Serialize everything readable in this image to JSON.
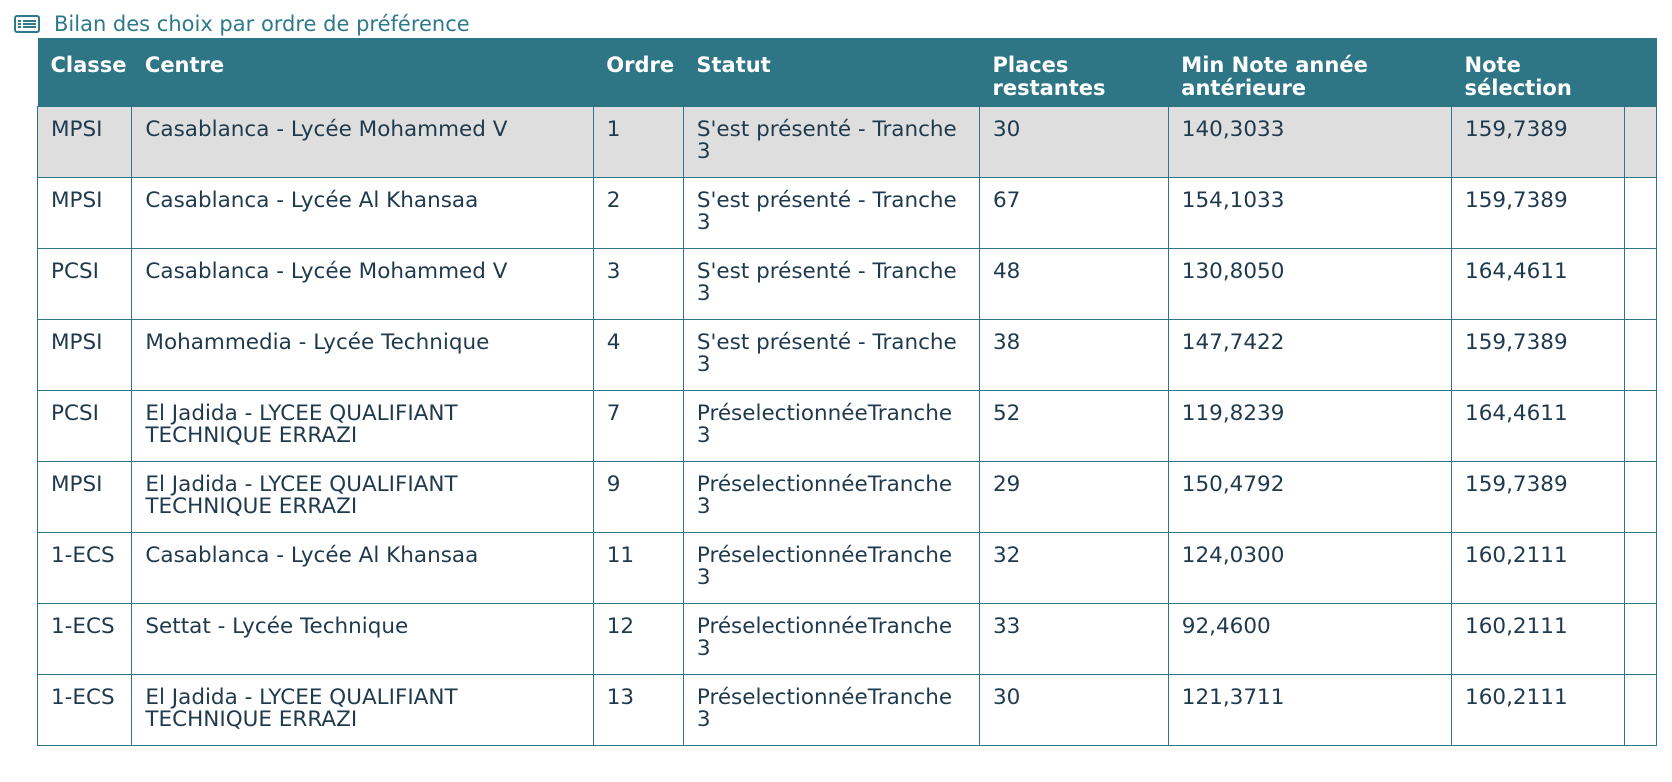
{
  "header": {
    "title": "Bilan des choix par ordre de préférence"
  },
  "table": {
    "columns": [
      "Classe",
      "Centre",
      "Ordre",
      "Statut",
      "Places restantes",
      "Min Note année antérieure",
      "Note sélection"
    ],
    "rows": [
      [
        "MPSI",
        "Casablanca - Lycée Mohammed V",
        "1",
        "S'est présenté - Tranche 3",
        "30",
        "140,3033",
        "159,7389"
      ],
      [
        "MPSI",
        "Casablanca - Lycée Al Khansaa",
        "2",
        "S'est présenté - Tranche 3",
        "67",
        "154,1033",
        "159,7389"
      ],
      [
        "PCSI",
        "Casablanca - Lycée Mohammed V",
        "3",
        "S'est présenté - Tranche 3",
        "48",
        "130,8050",
        "164,4611"
      ],
      [
        "MPSI",
        "Mohammedia - Lycée Technique",
        "4",
        "S'est présenté - Tranche 3",
        "38",
        "147,7422",
        "159,7389"
      ],
      [
        "PCSI",
        "El Jadida - LYCEE QUALIFIANT TECHNIQUE ERRAZI",
        "7",
        "PréselectionnéeTranche 3",
        "52",
        "119,8239",
        "164,4611"
      ],
      [
        "MPSI",
        "El Jadida - LYCEE QUALIFIANT TECHNIQUE ERRAZI",
        "9",
        "PréselectionnéeTranche 3",
        "29",
        "150,4792",
        "159,7389"
      ],
      [
        "1-ECS",
        "Casablanca - Lycée Al Khansaa",
        "11",
        "PréselectionnéeTranche 3",
        "32",
        "124,0300",
        "160,2111"
      ],
      [
        "1-ECS",
        "Settat - Lycée Technique",
        "12",
        "PréselectionnéeTranche 3",
        "33",
        "92,4600",
        "160,2111"
      ],
      [
        "1-ECS",
        "El Jadida - LYCEE QUALIFIANT TECHNIQUE ERRAZI",
        "13",
        "PréselectionnéeTranche 3",
        "30",
        "121,3711",
        "160,2111"
      ]
    ]
  },
  "colors": {
    "header_bg": "#2e7686",
    "title_text": "#2e7a8a",
    "highlight_row": "#dedede"
  },
  "icons": {
    "header_icon": "list-icon"
  }
}
